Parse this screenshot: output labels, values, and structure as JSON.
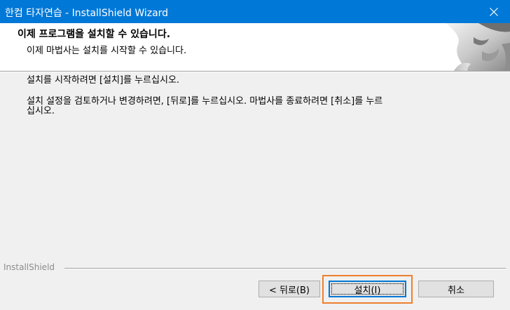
{
  "window": {
    "title": "한컴 타자연습 - InstallShield Wizard",
    "close_icon": "close-icon"
  },
  "header": {
    "title": "이제 프로그램을 설치할 수 있습니다.",
    "subtitle": "이제 마법사는 설치를 시작할 수 있습니다.",
    "logo_icon": "installshield-logo-icon"
  },
  "content": {
    "line1": "설치를 시작하려면 [설치]를 누르십시오.",
    "line2a": "설치 설정을 검토하거나 변경하려면, [뒤로]를 누르십시오. 마법사를 종료하려면 [취소]를 누르",
    "line2b": "십시오."
  },
  "footer": {
    "brand": "InstallShield",
    "buttons": {
      "back": "< 뒤로(B)",
      "install": "설치(I)",
      "cancel": "취소"
    }
  },
  "colors": {
    "titlebar": "#0078d7",
    "highlight": "#ef7f2d",
    "background": "#f0f0f0"
  }
}
